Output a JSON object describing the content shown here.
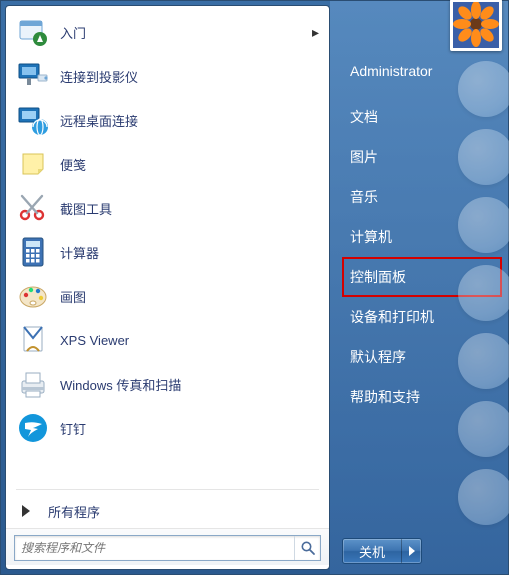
{
  "programs": [
    {
      "id": "getting-started",
      "label": "入门",
      "icon": "welcome",
      "hasSubmenu": true
    },
    {
      "id": "projector",
      "label": "连接到投影仪",
      "icon": "projector",
      "hasSubmenu": false
    },
    {
      "id": "rdp",
      "label": "远程桌面连接",
      "icon": "rdp",
      "hasSubmenu": false
    },
    {
      "id": "sticky",
      "label": "便笺",
      "icon": "sticky",
      "hasSubmenu": false
    },
    {
      "id": "snip",
      "label": "截图工具",
      "icon": "scissors",
      "hasSubmenu": false
    },
    {
      "id": "calc",
      "label": "计算器",
      "icon": "calc",
      "hasSubmenu": false
    },
    {
      "id": "paint",
      "label": "画图",
      "icon": "paint",
      "hasSubmenu": false
    },
    {
      "id": "xps",
      "label": "XPS Viewer",
      "icon": "xps",
      "hasSubmenu": false
    },
    {
      "id": "fax",
      "label": "Windows 传真和扫描",
      "icon": "fax",
      "hasSubmenu": false
    },
    {
      "id": "dingtalk",
      "label": "钉钉",
      "icon": "dingtalk",
      "hasSubmenu": false
    }
  ],
  "all_programs_label": "所有程序",
  "search_placeholder": "搜索程序和文件",
  "right": {
    "username": "Administrator",
    "items": [
      {
        "id": "documents",
        "label": "文档"
      },
      {
        "id": "pictures",
        "label": "图片"
      },
      {
        "id": "music",
        "label": "音乐"
      },
      {
        "id": "computer",
        "label": "计算机"
      },
      {
        "id": "control-panel",
        "label": "控制面板",
        "highlight": true
      },
      {
        "id": "devices",
        "label": "设备和打印机"
      },
      {
        "id": "defaults",
        "label": "默认程序"
      },
      {
        "id": "help",
        "label": "帮助和支持"
      }
    ]
  },
  "shutdown_label": "关机"
}
